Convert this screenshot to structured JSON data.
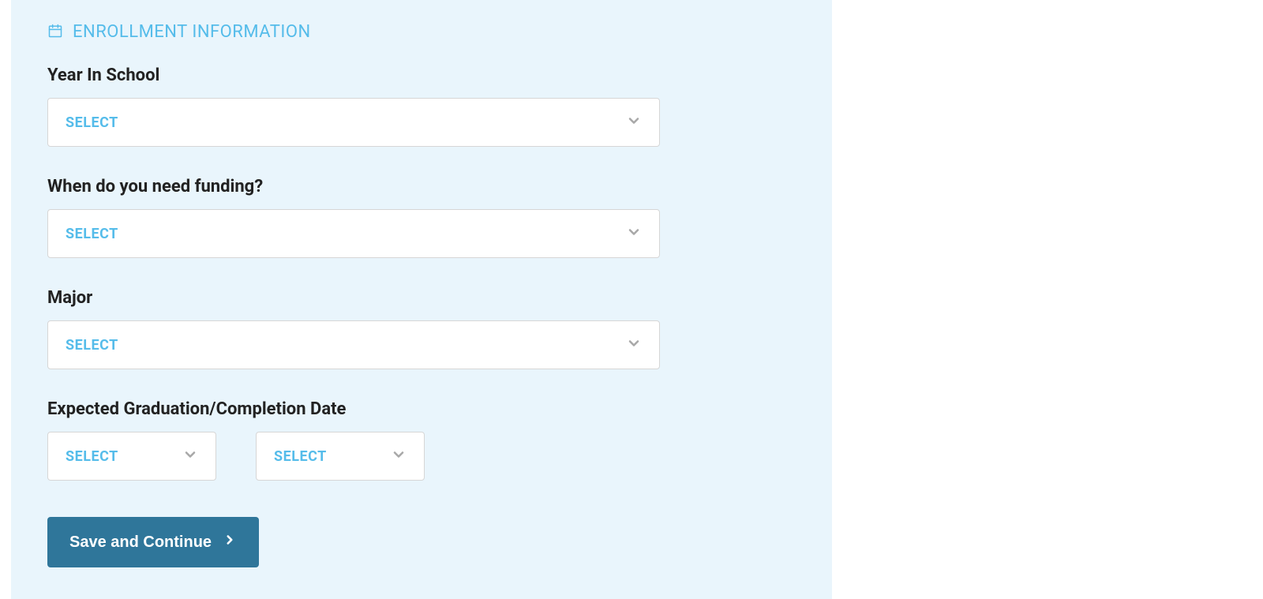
{
  "section": {
    "title": "Enrollment Information"
  },
  "fields": {
    "year_in_school": {
      "label": "Year In School",
      "placeholder": "Select"
    },
    "funding": {
      "label": "When do you need funding?",
      "placeholder": "Select"
    },
    "major": {
      "label": "Major",
      "placeholder": "Select"
    },
    "graduation": {
      "label": "Expected Graduation/Completion Date",
      "month_placeholder": "Select",
      "year_placeholder": "Select"
    }
  },
  "buttons": {
    "save_continue": "Save and Continue"
  },
  "colors": {
    "panel_bg": "#e9f5fc",
    "accent": "#55bcea",
    "button_bg": "#2f769a",
    "text": "#222222"
  }
}
